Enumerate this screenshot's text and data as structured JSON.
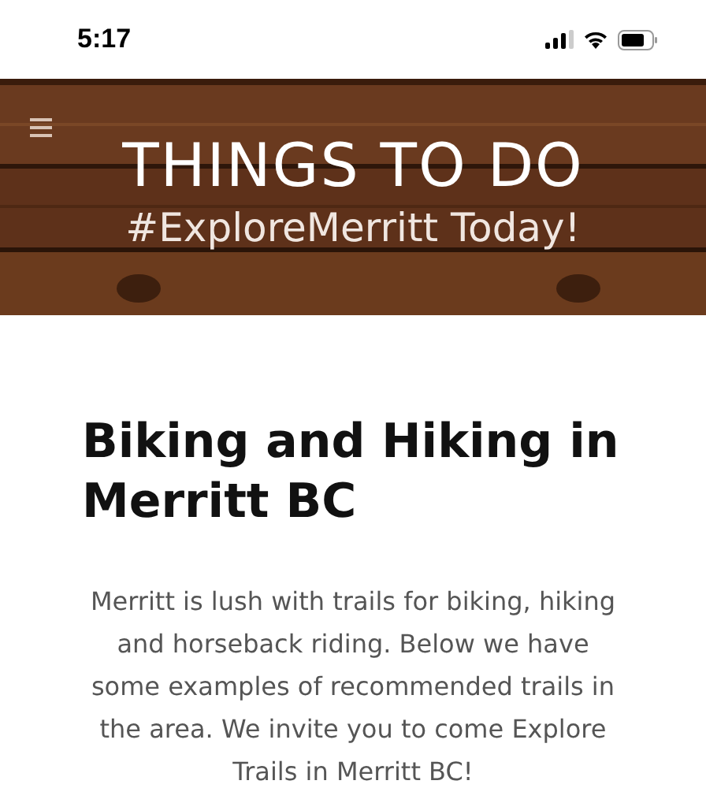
{
  "status_bar": {
    "time": "5:17"
  },
  "banner": {
    "kind": "picture",
    "title": "THINGS TO DO",
    "subtitle": "#ExploreMerritt Today!"
  },
  "article": {
    "heading": "Biking and Hiking in Merritt BC",
    "body": "Merritt is lush with trails for biking, hiking and horseback riding. Below we have some examples of recommended trails in the area. We invite you to come Explore Trails in Merritt BC!"
  }
}
